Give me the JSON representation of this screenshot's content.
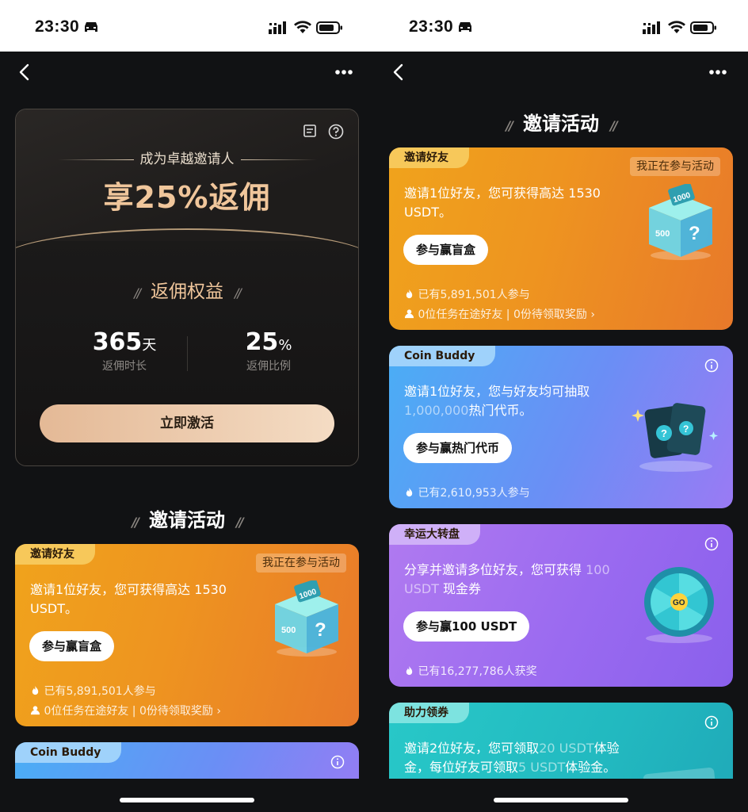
{
  "status": {
    "time": "23:30"
  },
  "left": {
    "hero": {
      "subtitle": "成为卓越邀请人",
      "headline": "享25%返佣",
      "section": "返佣权益",
      "stat1_value": "365",
      "stat1_unit": "天",
      "stat1_label": "返佣时长",
      "stat2_value": "25",
      "stat2_unit": "%",
      "stat2_label": "返佣比例",
      "cta": "立即激活"
    },
    "section_title": "邀请活动",
    "card1": {
      "tag": "邀请好友",
      "badge": "我正在参与活动",
      "title": "邀请1位好友，您可获得高达 1530 USDT。",
      "button": "参与赢盲盒",
      "participants": "已有5,891,501人参与",
      "friends": "0位任务在途好友 | 0份待领取奖励"
    },
    "card2": {
      "tag": "Coin Buddy"
    }
  },
  "right": {
    "section_title": "邀请活动",
    "card1": {
      "tag": "邀请好友",
      "badge": "我正在参与活动",
      "title": "邀请1位好友，您可获得高达 1530 USDT。",
      "button": "参与赢盲盒",
      "participants": "已有5,891,501人参与",
      "friends": "0位任务在途好友 | 0份待领取奖励"
    },
    "card2": {
      "tag": "Coin Buddy",
      "title_a": "邀请1位好友，您与好友均可抽取",
      "title_b": "1,000,000",
      "title_c": "热门代币。",
      "button": "参与赢热门代币",
      "participants": "已有2,610,953人参与"
    },
    "card3": {
      "tag": "幸运大转盘",
      "title_a": "分享并邀请多位好友，您可获得",
      "title_b": "100 USDT",
      "title_c": " 现金券",
      "button": "参与赢100 USDT",
      "participants": "已有16,277,786人获奖",
      "go": "GO"
    },
    "card4": {
      "tag": "助力领券",
      "title_a": "邀请2位好友，您可领取",
      "title_b": "20 USDT",
      "title_c": "体验金，每位好友可领取",
      "title_d": "5 USDT",
      "title_e": "体验金。"
    }
  },
  "art": {
    "box_a": "1000",
    "box_b": "500"
  },
  "colors": {
    "accent_gold": "#f0c69b",
    "cta_start": "#e4b996",
    "cta_end": "#f4dcc4"
  }
}
